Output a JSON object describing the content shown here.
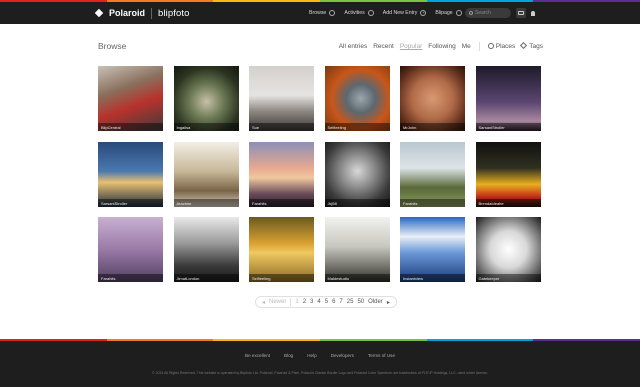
{
  "colors": {
    "stripe": [
      "#e2231a",
      "#f47b20",
      "#fdb913",
      "#7ac142",
      "#00a3da",
      "#5c2e91"
    ],
    "header_bg": "#1e1e1e"
  },
  "header": {
    "brand": "Polaroid",
    "site": "blipfoto",
    "nav": [
      {
        "label": "Browse",
        "icon": "compass-icon"
      },
      {
        "label": "Activities",
        "icon": "activity-icon"
      },
      {
        "label": "Add New Entry",
        "icon": "plus-icon"
      },
      {
        "label": "Blipage",
        "icon": "clock-icon"
      }
    ],
    "search_placeholder": "Search",
    "message_icon": "message-icon",
    "bell_icon": "bell-icon"
  },
  "browse": {
    "title": "Browse",
    "filters": [
      "All entries",
      "Recent",
      "Popular",
      "Following",
      "Me"
    ],
    "active_filter": "Popular",
    "places": "Places",
    "tags": "Tags"
  },
  "thumbnails": [
    {
      "user": "BlipCentral"
    },
    {
      "user": "Ingallsa"
    },
    {
      "user": "Sue"
    },
    {
      "user": "Selfleeling"
    },
    {
      "user": "MrJohn"
    },
    {
      "user": "SarsaniStroller"
    },
    {
      "user": "SarsaniStroller"
    },
    {
      "user": "Arachne"
    },
    {
      "user": "Farahits"
    },
    {
      "user": "Jkj58"
    },
    {
      "user": "Farahits"
    },
    {
      "user": "BrendaIdeahe"
    },
    {
      "user": "Farahits"
    },
    {
      "user": "JimatLondon"
    },
    {
      "user": "Selfleeling"
    },
    {
      "user": "Maldestudio"
    },
    {
      "user": "Instantview"
    },
    {
      "user": "Gatekeeper"
    }
  ],
  "pager": {
    "prev": "Newer",
    "current": "1",
    "pages": [
      "2",
      "3",
      "4",
      "5",
      "6",
      "7",
      "25",
      "50"
    ],
    "next": "Older"
  },
  "footer": {
    "links": [
      "Be excellent",
      "Blog",
      "Help",
      "Developers",
      "Terms of Use"
    ],
    "copyright": "© 2024 All Rights Reserved. This website is operated by Blipfoto Ltd. Polaroid, Polaroid & Pixel, Polaroid Classic Border Logo and Polaroid Color Spectrum are trademarks of PLR IP Holdings, LLC, used under license."
  }
}
